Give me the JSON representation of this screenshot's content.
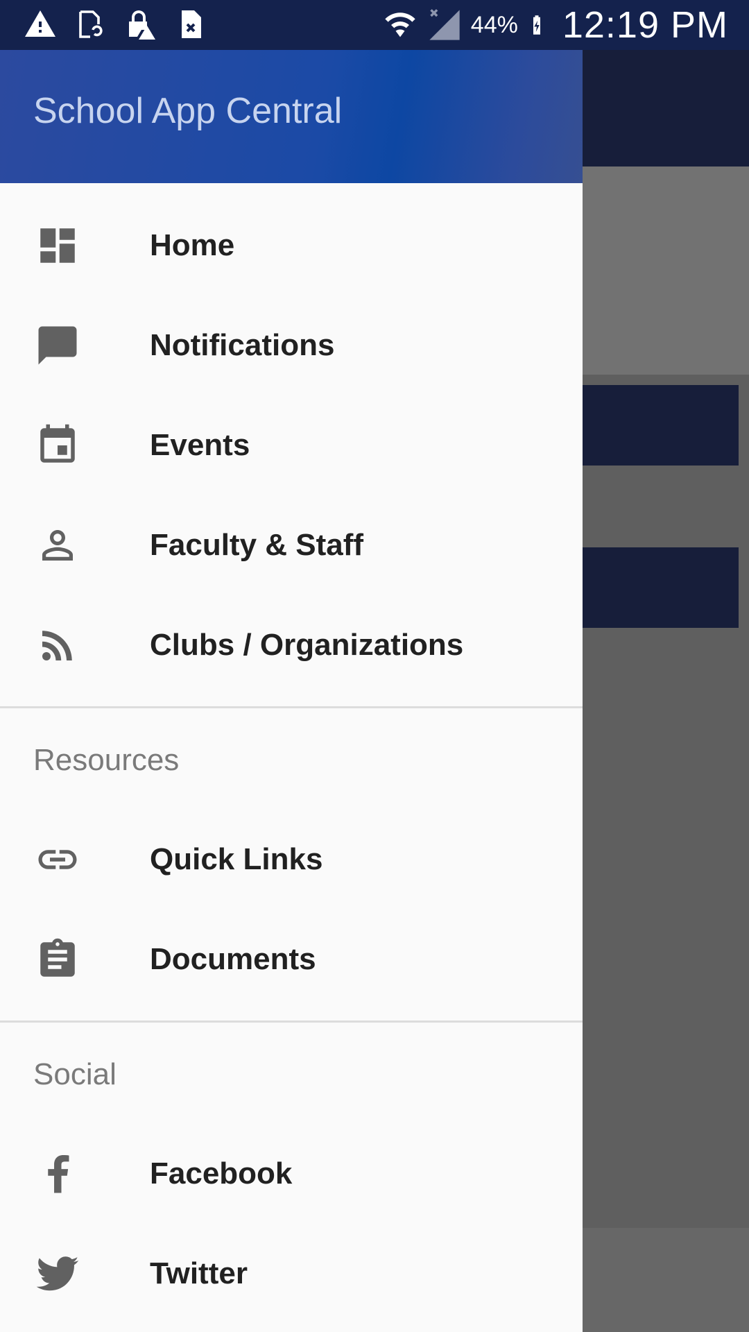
{
  "status_bar": {
    "battery": "44%",
    "time": "12:19 PM",
    "left_icons": [
      "alert-icon",
      "sync-file-icon",
      "lock-alert-icon",
      "file-x-icon"
    ],
    "right_icons": [
      "wifi-icon",
      "signal-icon",
      "battery-charging-icon"
    ]
  },
  "drawer": {
    "title": "School App Central",
    "items": [
      {
        "label": "Home",
        "icon": "dashboard-icon"
      },
      {
        "label": "Notifications",
        "icon": "chat-bubble-icon"
      },
      {
        "label": "Events",
        "icon": "calendar-icon"
      },
      {
        "label": "Faculty & Staff",
        "icon": "person-icon"
      },
      {
        "label": "Clubs / Organizations",
        "icon": "rss-icon"
      }
    ],
    "resources": {
      "header": "Resources",
      "items": [
        {
          "label": "Quick Links",
          "icon": "link-icon"
        },
        {
          "label": "Documents",
          "icon": "clipboard-icon"
        }
      ]
    },
    "social": {
      "header": "Social",
      "items": [
        {
          "label": "Facebook",
          "icon": "facebook-icon"
        },
        {
          "label": "Twitter",
          "icon": "twitter-icon"
        }
      ]
    }
  },
  "colors": {
    "status_bar": "#14224d",
    "header_blue": "#0d47a3",
    "background_toolbar": "#171e3a",
    "drawer_bg": "#fafafa",
    "icon_gray": "#616161"
  }
}
